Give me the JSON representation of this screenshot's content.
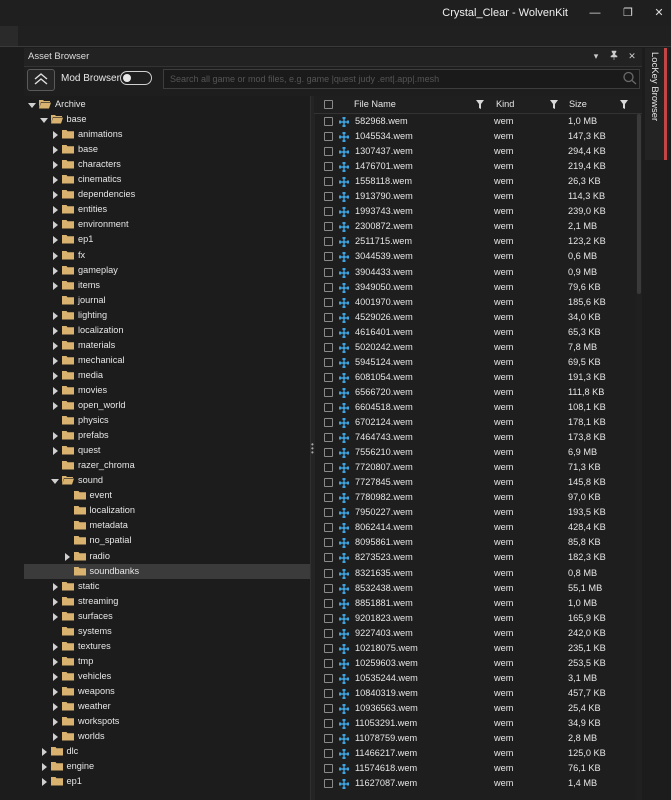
{
  "window": {
    "title": "Crystal_Clear - WolvenKit"
  },
  "panel": {
    "title": "Asset Browser"
  },
  "toolbar": {
    "mod_browser_label": "Mod Browser",
    "mod_browser_on": false,
    "search_placeholder": "Search all game or mod files, e.g. game |quest judy .ent|.app|.mesh"
  },
  "side_tab": {
    "label": "LocKey Browser"
  },
  "tree": [
    {
      "label": "Archive",
      "depth": 0,
      "expander": "expanded",
      "folder": "open"
    },
    {
      "label": "base",
      "depth": 1,
      "expander": "expanded",
      "folder": "open"
    },
    {
      "label": "animations",
      "depth": 2,
      "expander": "collapsed",
      "folder": "closed"
    },
    {
      "label": "base",
      "depth": 2,
      "expander": "collapsed",
      "folder": "closed"
    },
    {
      "label": "characters",
      "depth": 2,
      "expander": "collapsed",
      "folder": "closed"
    },
    {
      "label": "cinematics",
      "depth": 2,
      "expander": "collapsed",
      "folder": "closed"
    },
    {
      "label": "dependencies",
      "depth": 2,
      "expander": "collapsed",
      "folder": "closed"
    },
    {
      "label": "entities",
      "depth": 2,
      "expander": "collapsed",
      "folder": "closed"
    },
    {
      "label": "environment",
      "depth": 2,
      "expander": "collapsed",
      "folder": "closed"
    },
    {
      "label": "ep1",
      "depth": 2,
      "expander": "collapsed",
      "folder": "closed"
    },
    {
      "label": "fx",
      "depth": 2,
      "expander": "collapsed",
      "folder": "closed"
    },
    {
      "label": "gameplay",
      "depth": 2,
      "expander": "collapsed",
      "folder": "closed"
    },
    {
      "label": "items",
      "depth": 2,
      "expander": "collapsed",
      "folder": "closed"
    },
    {
      "label": "journal",
      "depth": 2,
      "expander": "none",
      "folder": "closed"
    },
    {
      "label": "lighting",
      "depth": 2,
      "expander": "collapsed",
      "folder": "closed"
    },
    {
      "label": "localization",
      "depth": 2,
      "expander": "collapsed",
      "folder": "closed"
    },
    {
      "label": "materials",
      "depth": 2,
      "expander": "collapsed",
      "folder": "closed"
    },
    {
      "label": "mechanical",
      "depth": 2,
      "expander": "collapsed",
      "folder": "closed"
    },
    {
      "label": "media",
      "depth": 2,
      "expander": "collapsed",
      "folder": "closed"
    },
    {
      "label": "movies",
      "depth": 2,
      "expander": "collapsed",
      "folder": "closed"
    },
    {
      "label": "open_world",
      "depth": 2,
      "expander": "collapsed",
      "folder": "closed"
    },
    {
      "label": "physics",
      "depth": 2,
      "expander": "none",
      "folder": "closed"
    },
    {
      "label": "prefabs",
      "depth": 2,
      "expander": "collapsed",
      "folder": "closed"
    },
    {
      "label": "quest",
      "depth": 2,
      "expander": "collapsed",
      "folder": "closed"
    },
    {
      "label": "razer_chroma",
      "depth": 2,
      "expander": "none",
      "folder": "closed"
    },
    {
      "label": "sound",
      "depth": 2,
      "expander": "expanded",
      "folder": "open"
    },
    {
      "label": "event",
      "depth": 3,
      "expander": "none",
      "folder": "closed"
    },
    {
      "label": "localization",
      "depth": 3,
      "expander": "none",
      "folder": "closed"
    },
    {
      "label": "metadata",
      "depth": 3,
      "expander": "none",
      "folder": "closed"
    },
    {
      "label": "no_spatial",
      "depth": 3,
      "expander": "none",
      "folder": "closed"
    },
    {
      "label": "radio",
      "depth": 3,
      "expander": "collapsed",
      "folder": "closed"
    },
    {
      "label": "soundbanks",
      "depth": 3,
      "expander": "none",
      "folder": "closed",
      "selected": true
    },
    {
      "label": "static",
      "depth": 2,
      "expander": "collapsed",
      "folder": "closed"
    },
    {
      "label": "streaming",
      "depth": 2,
      "expander": "collapsed",
      "folder": "closed"
    },
    {
      "label": "surfaces",
      "depth": 2,
      "expander": "collapsed",
      "folder": "closed"
    },
    {
      "label": "systems",
      "depth": 2,
      "expander": "none",
      "folder": "closed"
    },
    {
      "label": "textures",
      "depth": 2,
      "expander": "collapsed",
      "folder": "closed"
    },
    {
      "label": "tmp",
      "depth": 2,
      "expander": "collapsed",
      "folder": "closed"
    },
    {
      "label": "vehicles",
      "depth": 2,
      "expander": "collapsed",
      "folder": "closed"
    },
    {
      "label": "weapons",
      "depth": 2,
      "expander": "collapsed",
      "folder": "closed"
    },
    {
      "label": "weather",
      "depth": 2,
      "expander": "collapsed",
      "folder": "closed"
    },
    {
      "label": "workspots",
      "depth": 2,
      "expander": "collapsed",
      "folder": "closed"
    },
    {
      "label": "worlds",
      "depth": 2,
      "expander": "collapsed",
      "folder": "closed"
    },
    {
      "label": "dlc",
      "depth": 1,
      "expander": "collapsed",
      "folder": "closed"
    },
    {
      "label": "engine",
      "depth": 1,
      "expander": "collapsed",
      "folder": "closed"
    },
    {
      "label": "ep1",
      "depth": 1,
      "expander": "collapsed",
      "folder": "closed"
    }
  ],
  "files": {
    "columns": {
      "name": "File Name",
      "kind": "Kind",
      "size": "Size"
    },
    "rows": [
      {
        "name": "582968.wem",
        "kind": "wem",
        "size": "1,0 MB"
      },
      {
        "name": "1045534.wem",
        "kind": "wem",
        "size": "147,3 KB"
      },
      {
        "name": "1307437.wem",
        "kind": "wem",
        "size": "294,4 KB"
      },
      {
        "name": "1476701.wem",
        "kind": "wem",
        "size": "219,4 KB"
      },
      {
        "name": "1558118.wem",
        "kind": "wem",
        "size": "26,3 KB"
      },
      {
        "name": "1913790.wem",
        "kind": "wem",
        "size": "114,3 KB"
      },
      {
        "name": "1993743.wem",
        "kind": "wem",
        "size": "239,0 KB"
      },
      {
        "name": "2300872.wem",
        "kind": "wem",
        "size": "2,1 MB"
      },
      {
        "name": "2511715.wem",
        "kind": "wem",
        "size": "123,2 KB"
      },
      {
        "name": "3044539.wem",
        "kind": "wem",
        "size": "0,6 MB"
      },
      {
        "name": "3904433.wem",
        "kind": "wem",
        "size": "0,9 MB"
      },
      {
        "name": "3949050.wem",
        "kind": "wem",
        "size": "79,6 KB"
      },
      {
        "name": "4001970.wem",
        "kind": "wem",
        "size": "185,6 KB"
      },
      {
        "name": "4529026.wem",
        "kind": "wem",
        "size": "34,0 KB"
      },
      {
        "name": "4616401.wem",
        "kind": "wem",
        "size": "65,3 KB"
      },
      {
        "name": "5020242.wem",
        "kind": "wem",
        "size": "7,8 MB"
      },
      {
        "name": "5945124.wem",
        "kind": "wem",
        "size": "69,5 KB"
      },
      {
        "name": "6081054.wem",
        "kind": "wem",
        "size": "191,3 KB"
      },
      {
        "name": "6566720.wem",
        "kind": "wem",
        "size": "111,8 KB"
      },
      {
        "name": "6604518.wem",
        "kind": "wem",
        "size": "108,1 KB"
      },
      {
        "name": "6702124.wem",
        "kind": "wem",
        "size": "178,1 KB"
      },
      {
        "name": "7464743.wem",
        "kind": "wem",
        "size": "173,8 KB"
      },
      {
        "name": "7556210.wem",
        "kind": "wem",
        "size": "6,9 MB"
      },
      {
        "name": "7720807.wem",
        "kind": "wem",
        "size": "71,3 KB"
      },
      {
        "name": "7727845.wem",
        "kind": "wem",
        "size": "145,8 KB"
      },
      {
        "name": "7780982.wem",
        "kind": "wem",
        "size": "97,0 KB"
      },
      {
        "name": "7950227.wem",
        "kind": "wem",
        "size": "193,5 KB"
      },
      {
        "name": "8062414.wem",
        "kind": "wem",
        "size": "428,4 KB"
      },
      {
        "name": "8095861.wem",
        "kind": "wem",
        "size": "85,8 KB"
      },
      {
        "name": "8273523.wem",
        "kind": "wem",
        "size": "182,3 KB"
      },
      {
        "name": "8321635.wem",
        "kind": "wem",
        "size": "0,8 MB"
      },
      {
        "name": "8532438.wem",
        "kind": "wem",
        "size": "55,1 MB"
      },
      {
        "name": "8851881.wem",
        "kind": "wem",
        "size": "1,0 MB"
      },
      {
        "name": "9201823.wem",
        "kind": "wem",
        "size": "165,9 KB"
      },
      {
        "name": "9227403.wem",
        "kind": "wem",
        "size": "242,0 KB"
      },
      {
        "name": "10218075.wem",
        "kind": "wem",
        "size": "235,1 KB"
      },
      {
        "name": "10259603.wem",
        "kind": "wem",
        "size": "253,5 KB"
      },
      {
        "name": "10535244.wem",
        "kind": "wem",
        "size": "3,1 MB"
      },
      {
        "name": "10840319.wem",
        "kind": "wem",
        "size": "457,7 KB"
      },
      {
        "name": "10936563.wem",
        "kind": "wem",
        "size": "25,4 KB"
      },
      {
        "name": "11053291.wem",
        "kind": "wem",
        "size": "34,9 KB"
      },
      {
        "name": "11078759.wem",
        "kind": "wem",
        "size": "2,8 MB"
      },
      {
        "name": "11466217.wem",
        "kind": "wem",
        "size": "125,0 KB"
      },
      {
        "name": "11574618.wem",
        "kind": "wem",
        "size": "76,1 KB"
      },
      {
        "name": "11627087.wem",
        "kind": "wem",
        "size": "1,4 MB"
      }
    ]
  },
  "colors": {
    "background": "#1c1c1c",
    "selection": "#3b3b3b",
    "folder": "#d9b26f",
    "file_icon": "#3fa3e0",
    "accent_tab": "#c44545"
  },
  "icons": {
    "up": "chevron-up-icon",
    "search": "search-icon",
    "folder": "folder-icon",
    "file": "audio-file-icon",
    "filter": "filter-icon"
  }
}
